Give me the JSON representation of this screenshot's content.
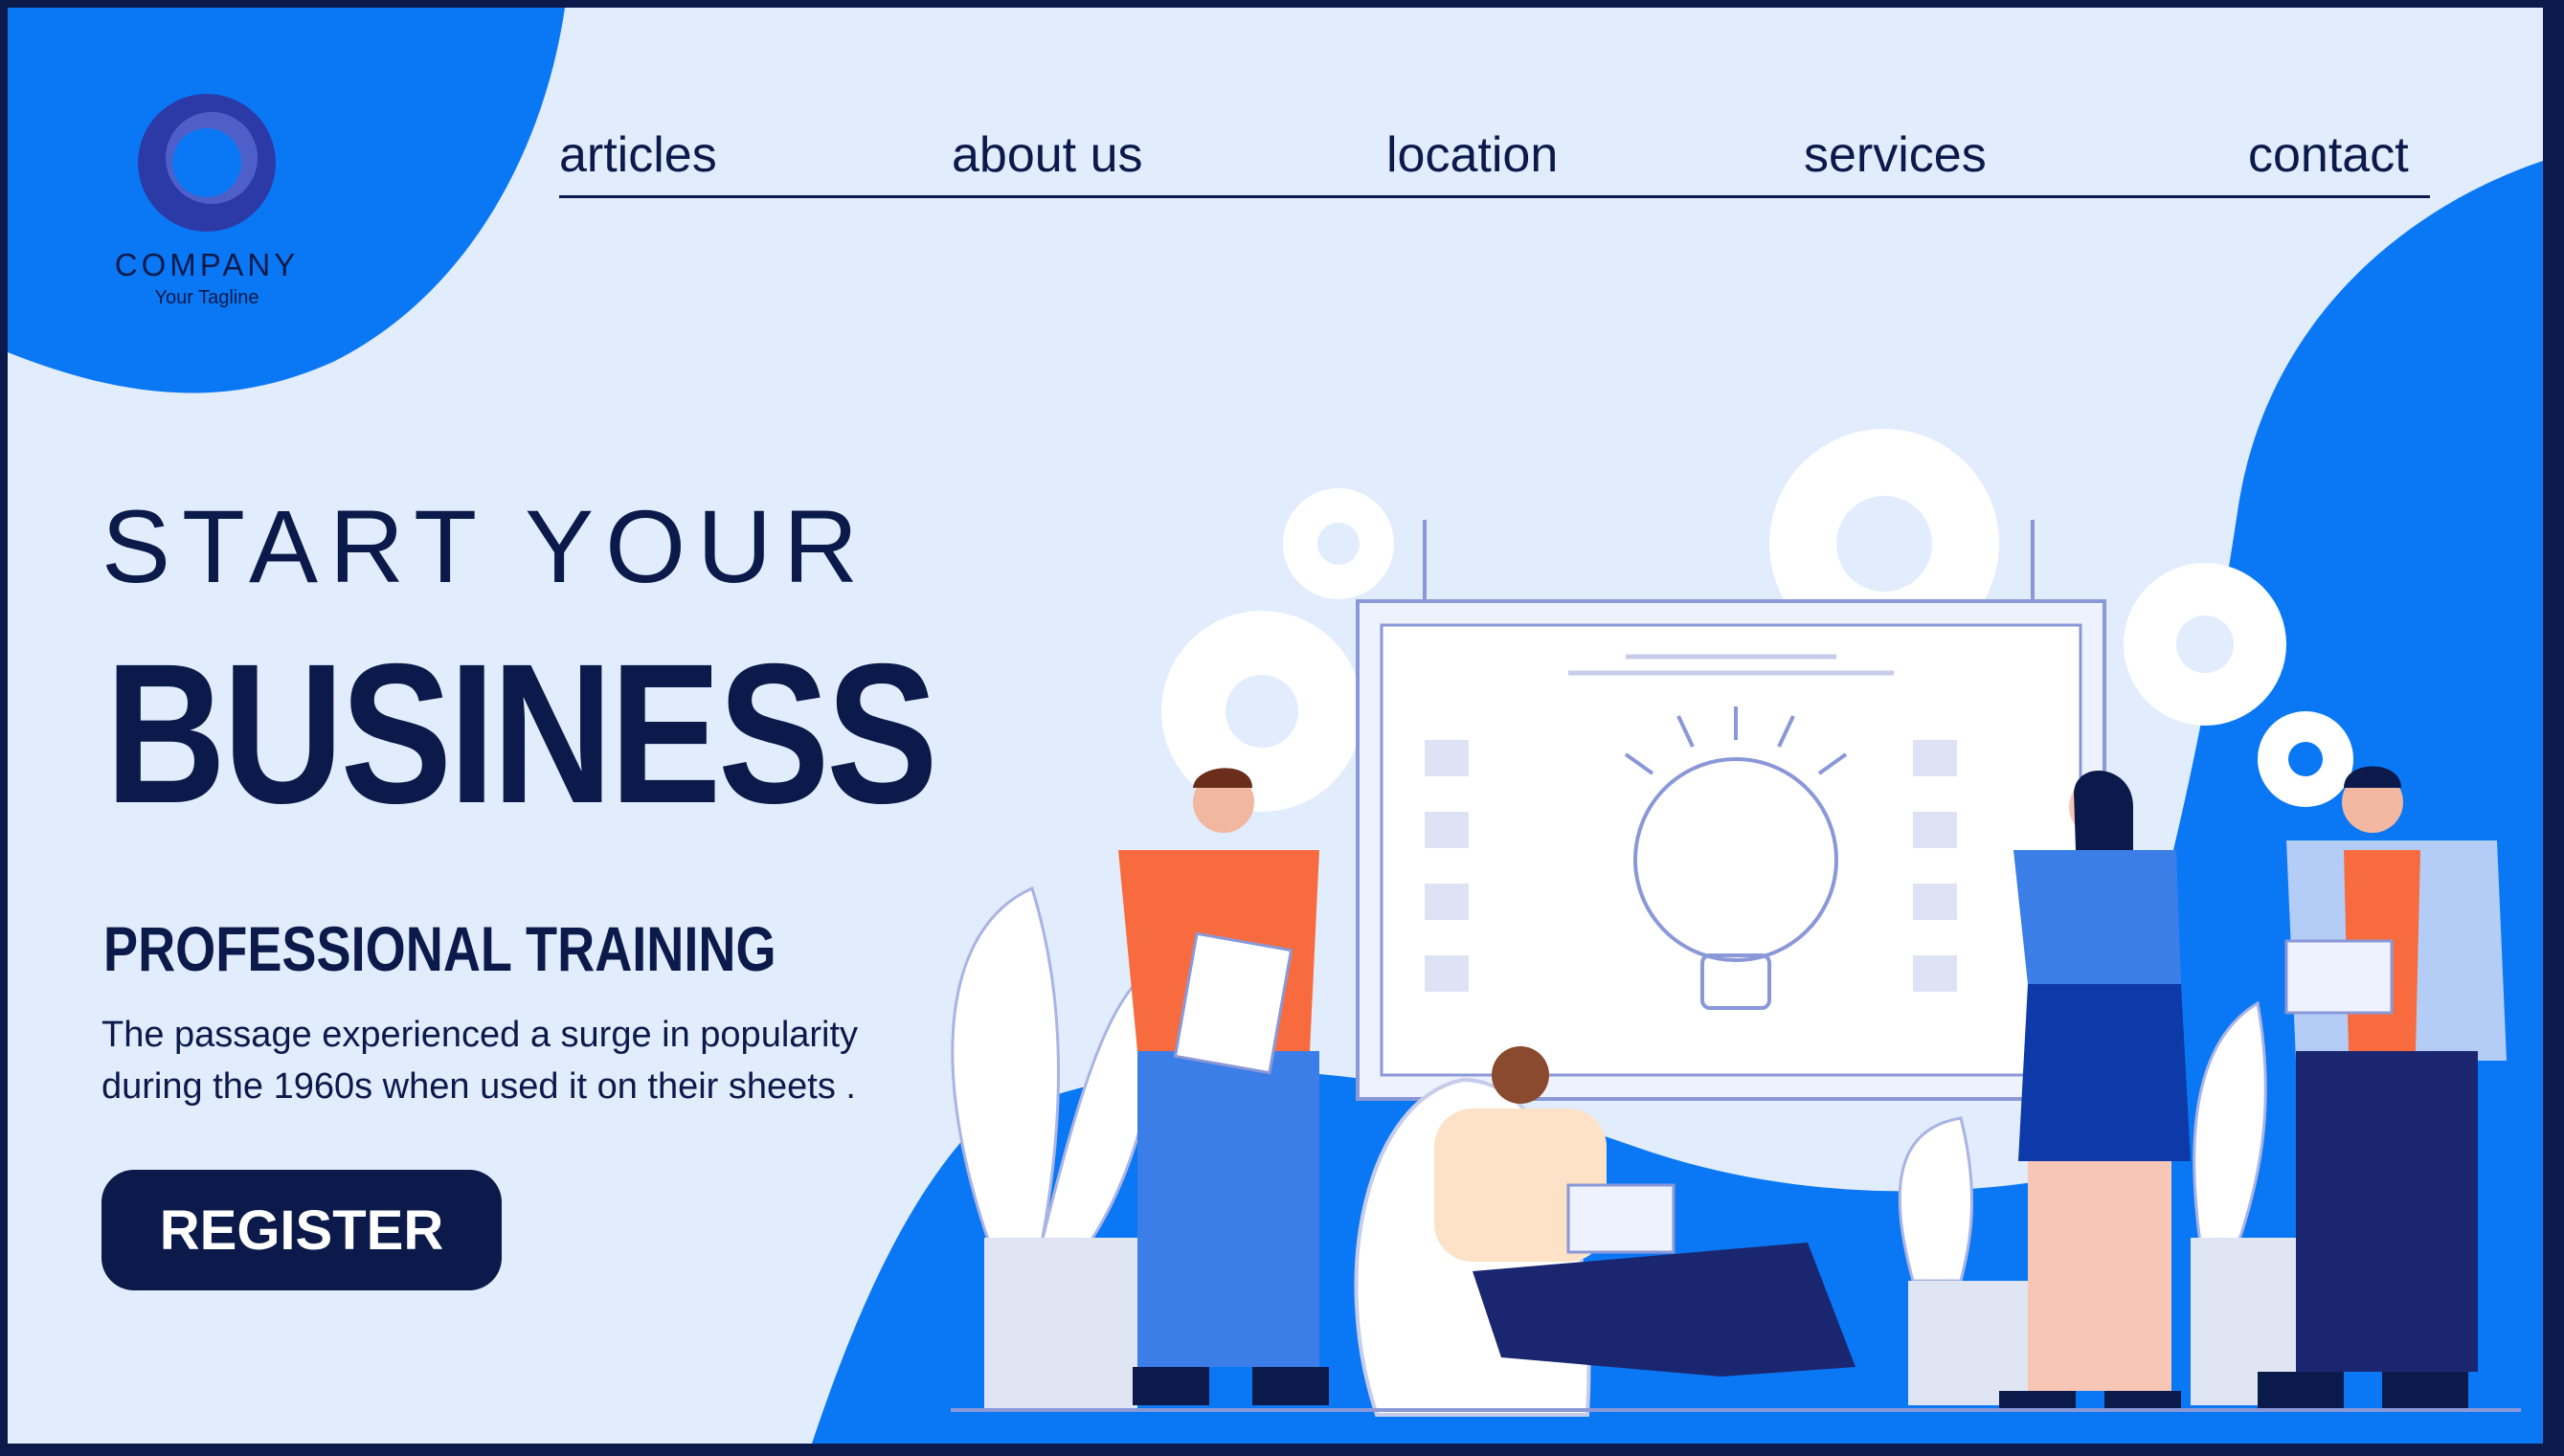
{
  "company": {
    "name": "COMPANY",
    "tagline": "Your Tagline"
  },
  "nav": [
    {
      "label": "articles"
    },
    {
      "label": "about us"
    },
    {
      "label": "location"
    },
    {
      "label": "services"
    },
    {
      "label": "contact"
    }
  ],
  "hero": {
    "line1": "START YOUR",
    "line2": "BUSINESS",
    "subheading": "PROFESSIONAL TRAINING",
    "description": "The passage experienced a surge in popularity during the 1960s when used it on their sheets .",
    "cta_label": "REGISTER"
  },
  "colors": {
    "navy": "#0b1a4a",
    "brand_blue": "#0a78f5",
    "background": "#e1ecfd"
  },
  "icons": [
    "company-logo-icon",
    "gear-icon",
    "lightbulb-icon"
  ]
}
